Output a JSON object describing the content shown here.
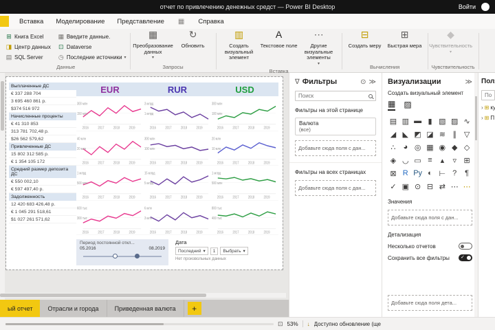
{
  "title_bar": {
    "title": "отчет по привлечению денежных средст — Power BI Desktop",
    "sign_in": "Войти"
  },
  "ribbon_tabs": [
    "Вставка",
    "Моделирование",
    "Представление",
    "Справка"
  ],
  "ribbon": {
    "groups": [
      {
        "id": "data",
        "label": "Данные",
        "layout": "small",
        "buttons": [
          {
            "name": "excel-workbook-button",
            "icon": "excel-icon",
            "glyph": "⊞",
            "color": "#217346",
            "label": "Книга Excel"
          },
          {
            "name": "data-hub-button",
            "icon": "data-hub-icon",
            "glyph": "◨",
            "color": "#c19c00",
            "label": "Центр данных"
          },
          {
            "name": "sql-server-button",
            "icon": "database-icon",
            "glyph": "▤",
            "color": "#7a7874",
            "label": "SQL Server"
          },
          {
            "name": "enter-data-button",
            "icon": "table-grid-icon",
            "glyph": "▦",
            "color": "#7a7874",
            "label": "Введите данные."
          },
          {
            "name": "dataverse-button",
            "icon": "dataverse-icon",
            "glyph": "⊡",
            "color": "#217346",
            "label": "Dataverse"
          },
          {
            "name": "recent-sources-button",
            "icon": "clock-icon",
            "glyph": "◷",
            "color": "#7a7874",
            "label": "Последние источники",
            "dropdown": true
          }
        ]
      },
      {
        "id": "queries",
        "label": "Запросы",
        "layout": "large",
        "buttons": [
          {
            "name": "transform-data-button",
            "icon": "transform-data-icon",
            "glyph": "▦",
            "color": "#605e5c",
            "label": "Преобразование данных",
            "dropdown": true
          },
          {
            "name": "refresh-button",
            "icon": "refresh-icon",
            "glyph": "↻",
            "color": "#605e5c",
            "label": "Обновить"
          }
        ]
      },
      {
        "id": "insert",
        "label": "Вставка",
        "layout": "large",
        "buttons": [
          {
            "name": "new-visual-button",
            "icon": "new-visual-icon",
            "glyph": "▥",
            "color": "#c19c00",
            "label": "Создать визуальный элемент"
          },
          {
            "name": "text-box-button",
            "icon": "text-box-icon",
            "glyph": "A",
            "color": "#252423",
            "label": "Текстовое поле"
          },
          {
            "name": "more-visuals-button",
            "icon": "more-visuals-icon",
            "glyph": "⋯",
            "color": "#605e5c",
            "label": "Другие визуальные элементы",
            "dropdown": true
          }
        ]
      },
      {
        "id": "calculations",
        "label": "Вычисления",
        "layout": "large",
        "buttons": [
          {
            "name": "new-measure-button",
            "icon": "calculator-icon",
            "glyph": "⊟",
            "color": "#c19c00",
            "label": "Создать меру"
          },
          {
            "name": "quick-measure-button",
            "icon": "calculator-plus-icon",
            "glyph": "⊞",
            "color": "#605e5c",
            "label": "Быстрая мера"
          }
        ]
      },
      {
        "id": "sensitivity",
        "label": "Чувствительность",
        "layout": "large",
        "buttons": [
          {
            "name": "sensitivity-button",
            "icon": "sensitivity-icon",
            "glyph": "◆",
            "color": "#8a8886",
            "label": "Чувствительность",
            "dropdown": true,
            "disabled": true
          }
        ]
      }
    ]
  },
  "report": {
    "currency_headers": [
      {
        "label": "EUR",
        "color": "#8e2f9e"
      },
      {
        "label": "RUR",
        "color": "#4b36b0"
      },
      {
        "label": "USD",
        "color": "#1f9e3e"
      }
    ],
    "metrics": [
      {
        "label": "Выплаченные ДС",
        "values": [
          "€ 337 288 704",
          "3 695 460 861 р.",
          "$374 516 972"
        ]
      },
      {
        "label": "Начисленные проценты",
        "values": [
          "€ 41 310 853",
          "313 781 702,48 р.",
          "$26 562 579,62"
        ]
      },
      {
        "label": "Привлеченные ДС",
        "values": [
          "15 802 312 585 р.",
          "€ 1 354 105 172"
        ]
      },
      {
        "label": "Средний размер депозита ДС",
        "values": [
          "€ 550 002,10",
          "€ 597 497,40 р."
        ]
      },
      {
        "label": "Задолженность",
        "values": [
          "12 420 683 426,48 р.",
          "€ 1 045 291 518,61",
          "$1 027 261 571,62"
        ]
      }
    ],
    "years": [
      "2016",
      "2017",
      "2018",
      "2019"
    ],
    "charts": [
      {
        "currency": "EUR",
        "metric": "Выплаченные ДС",
        "color": "#e8398f",
        "yticks": [
          "300 млн",
          "150 млн"
        ],
        "values": [
          35,
          65,
          40,
          78,
          52,
          88,
          60,
          72
        ]
      },
      {
        "currency": "RUR",
        "metric": "Выплаченные ДС",
        "color": "#6b3fa0",
        "yticks": [
          "3 млрд",
          "1 млрд"
        ],
        "values": [
          80,
          62,
          70,
          45,
          58,
          32,
          48,
          25
        ]
      },
      {
        "currency": "USD",
        "metric": "Выплаченные ДС",
        "color": "#2e9e44",
        "yticks": [
          "300 млн",
          "100 млн"
        ],
        "values": [
          25,
          40,
          32,
          55,
          48,
          70,
          62,
          85
        ]
      },
      {
        "currency": "EUR",
        "metric": "Начисленные проценты",
        "color": "#e8398f",
        "yticks": [
          "40 млн",
          "20 млн"
        ],
        "values": [
          50,
          22,
          60,
          33,
          72,
          48,
          85,
          58
        ]
      },
      {
        "currency": "RUR",
        "metric": "Начисленные проценты",
        "color": "#6b3fa0",
        "yticks": [
          "300 млн",
          "100 млн"
        ],
        "values": [
          68,
          74,
          60,
          66,
          50,
          58,
          42,
          48
        ]
      },
      {
        "currency": "USD",
        "metric": "Начисленные проценты",
        "color": "#5a5fd0",
        "yticks": [
          "20 млн",
          "10 млн"
        ],
        "values": [
          30,
          58,
          44,
          68,
          52,
          78,
          64,
          55
        ]
      },
      {
        "currency": "EUR",
        "metric": "Привлеченные ДС",
        "color": "#e8398f",
        "yticks": [
          "1 млрд",
          "500 млн"
        ],
        "values": [
          42,
          56,
          36,
          62,
          50,
          76,
          58,
          70
        ]
      },
      {
        "currency": "RUR",
        "metric": "Привлеченные ДС",
        "color": "#6b3fa0",
        "yticks": [
          "15 млрд",
          "5 млрд"
        ],
        "values": [
          60,
          42,
          70,
          46,
          80,
          55,
          66,
          84
        ]
      },
      {
        "currency": "USD",
        "metric": "Привлеченные ДС",
        "color": "#2e9e44",
        "yticks": [
          "1 млрд",
          "500 млн"
        ],
        "values": [
          74,
          70,
          77,
          64,
          71,
          60,
          67,
          56
        ]
      },
      {
        "currency": "EUR",
        "metric": "Средний размер депозита ДС",
        "color": "#e8398f",
        "yticks": [
          "600 тыс",
          "300 тыс"
        ],
        "values": [
          28,
          46,
          36,
          60,
          50,
          72,
          62,
          84
        ]
      },
      {
        "currency": "RUR",
        "metric": "Средний размер депозита ДС",
        "color": "#6b3fa0",
        "yticks": [
          "6 млн",
          "3 млн"
        ],
        "values": [
          56,
          36,
          66,
          42,
          76,
          52,
          62,
          46
        ]
      },
      {
        "currency": "USD",
        "metric": "Средний размер депозита ДС",
        "color": "#2e9e44",
        "yticks": [
          "800 тыс",
          "400 тыс"
        ],
        "values": [
          64,
          60,
          70,
          56,
          74,
          60,
          80,
          70
        ]
      }
    ],
    "period_slicer": {
      "title": "Период постоянной откл...",
      "start": "05.2016",
      "end": "08.2019"
    },
    "date_slicer": {
      "title": "Дата",
      "mode": "Последний",
      "value": "1",
      "unit": "Выбрать",
      "note": "Нет произвольных данных"
    }
  },
  "filters": {
    "title": "Фильтры",
    "search_placeholder": "Поиск",
    "page_section": "Фильтры на этой странице",
    "card_field": "Валюта",
    "card_value": "(все)",
    "drop_hint": "Добавьте сюда поля с дан...",
    "all_pages_section": "Фильтры на всех страницах",
    "drop_hint2": "Добавьте сюда поля с дан..."
  },
  "visualizations": {
    "title": "Визуализации",
    "subtitle": "Создать визуальный элемент",
    "values_label": "Значения",
    "values_drop": "Добавьте сюда поля с дан...",
    "drill_label": "Детализация",
    "multiple_reports_label": "Несколько отчетов",
    "keep_filters_label": "Сохранить все фильтры",
    "drill_drop": "Добавьте сюда поля дета...",
    "icons": [
      {
        "name": "stacked-bar-chart-icon",
        "glyph": "▤"
      },
      {
        "name": "stacked-column-chart-icon",
        "glyph": "▥"
      },
      {
        "name": "clustered-bar-chart-icon",
        "glyph": "▬"
      },
      {
        "name": "clustered-column-chart-icon",
        "glyph": "▮"
      },
      {
        "name": "100-stacked-bar-chart-icon",
        "glyph": "▧"
      },
      {
        "name": "100-stacked-column-chart-icon",
        "glyph": "▨"
      },
      {
        "name": "line-chart-icon",
        "glyph": "∿"
      },
      {
        "name": "area-chart-icon",
        "glyph": "◢"
      },
      {
        "name": "stacked-area-chart-icon",
        "glyph": "◣"
      },
      {
        "name": "line-and-stacked-column-chart-icon",
        "glyph": "◩"
      },
      {
        "name": "line-and-clustered-column-chart-icon",
        "glyph": "◪"
      },
      {
        "name": "ribbon-chart-icon",
        "glyph": "≋"
      },
      {
        "name": "waterfall-chart-icon",
        "glyph": "∥"
      },
      {
        "name": "funnel-chart-icon",
        "glyph": "▽"
      },
      {
        "name": "scatter-chart-icon",
        "glyph": "∴"
      },
      {
        "name": "pie-chart-icon",
        "glyph": "◕"
      },
      {
        "name": "donut-chart-icon",
        "glyph": "◎"
      },
      {
        "name": "treemap-icon",
        "glyph": "▦"
      },
      {
        "name": "map-icon",
        "glyph": "◉"
      },
      {
        "name": "filled-map-icon",
        "glyph": "◆"
      },
      {
        "name": "shape-map-icon",
        "glyph": "◇"
      },
      {
        "name": "azure-map-icon",
        "glyph": "◈"
      },
      {
        "name": "gauge-icon",
        "glyph": "◡"
      },
      {
        "name": "card-icon",
        "glyph": "▭"
      },
      {
        "name": "multi-row-card-icon",
        "glyph": "≡"
      },
      {
        "name": "kpi-icon",
        "glyph": "▴"
      },
      {
        "name": "slicer-icon",
        "glyph": "▿"
      },
      {
        "name": "table-visual-icon",
        "glyph": "⊞"
      },
      {
        "name": "matrix-visual-icon",
        "glyph": "⊠"
      },
      {
        "name": "r-script-visual-icon",
        "glyph": "R",
        "color": "#276dc3"
      },
      {
        "name": "python-visual-icon",
        "glyph": "Py",
        "color": "#2b5b84"
      },
      {
        "name": "key-influencers-icon",
        "glyph": "◐"
      },
      {
        "name": "decomposition-tree-icon",
        "glyph": "⊢"
      },
      {
        "name": "qa-visual-icon",
        "glyph": "?"
      },
      {
        "name": "smart-narrative-icon",
        "glyph": "¶"
      },
      {
        "name": "metrics-visual-icon",
        "glyph": "✓"
      },
      {
        "name": "paginated-report-icon",
        "glyph": "▣"
      },
      {
        "name": "arcgis-map-icon",
        "glyph": "⊙"
      },
      {
        "name": "power-apps-icon",
        "glyph": "⊟"
      },
      {
        "name": "power-automate-icon",
        "glyph": "⇄"
      },
      {
        "name": "more-visuals-icon",
        "glyph": "⋯"
      },
      {
        "name": "get-more-visuals-icon",
        "glyph": "⋯",
        "color": "#c19c00"
      }
    ]
  },
  "fields": {
    "title": "Поля",
    "search_placeholder": "Поиск",
    "items": [
      {
        "label": "ку"
      },
      {
        "label": "П"
      }
    ]
  },
  "page_tabs": {
    "tabs": [
      {
        "label": "ый отчет",
        "active": true
      },
      {
        "label": "Отрасли и города",
        "active": false
      },
      {
        "label": "Приведенная валюта",
        "active": false
      }
    ],
    "add": "+"
  },
  "status_bar": {
    "zoom": "53%",
    "update": "Доступно обновление (ще"
  },
  "colors": {
    "accent": "#f2c811",
    "table_header": "#dbe5f1"
  }
}
